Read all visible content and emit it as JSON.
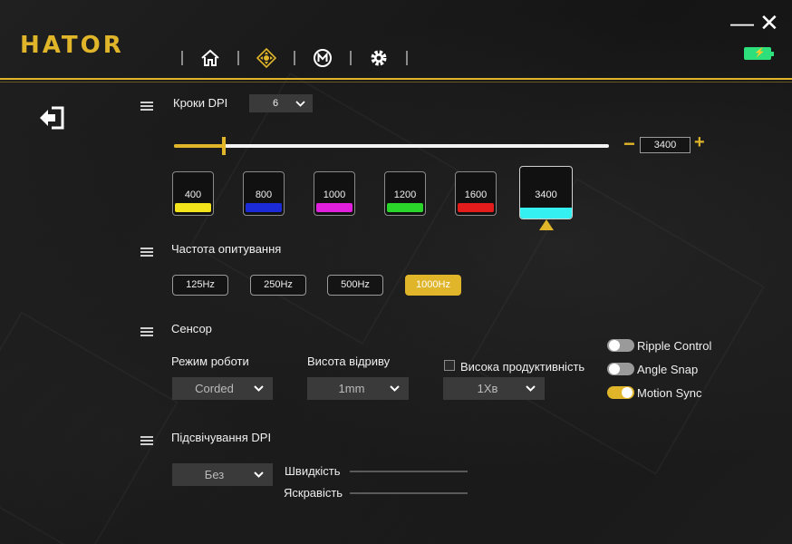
{
  "app": {
    "logo": "HATOR"
  },
  "nav": {
    "items": [
      "home-icon",
      "dpi-icon",
      "macro-icon",
      "settings-icon"
    ]
  },
  "window": {
    "minimize": "—",
    "close": "✕"
  },
  "dpi_steps": {
    "title": "Кроки DPI",
    "steps_value": "6"
  },
  "dpi_slider": {
    "value": "3400",
    "fill_fraction": 0.115,
    "minus": "−",
    "plus": "+"
  },
  "dpi_levels": [
    {
      "label": "400",
      "color": "#f2e31b"
    },
    {
      "label": "800",
      "color": "#1c2bd8"
    },
    {
      "label": "1000",
      "color": "#e01fdc"
    },
    {
      "label": "1200",
      "color": "#2ad62a"
    },
    {
      "label": "1600",
      "color": "#e41c1c"
    },
    {
      "label": "3400",
      "color": "#35f0f0",
      "selected": true
    }
  ],
  "polling": {
    "title": "Частота опитування",
    "options": [
      "125Hz",
      "250Hz",
      "500Hz",
      "1000Hz"
    ],
    "selected": "1000Hz"
  },
  "sensor": {
    "title": "Сенсор",
    "mode_label": "Режим роботи",
    "mode_value": "Corded",
    "lod_label": "Висота відриву",
    "lod_value": "1mm",
    "high_perf_label": "Висока продуктивність",
    "high_perf_value": "1Xв",
    "toggles": [
      {
        "label": "Ripple Control",
        "on": false
      },
      {
        "label": "Angle Snap",
        "on": false
      },
      {
        "label": "Motion Sync",
        "on": true
      }
    ]
  },
  "lighting": {
    "title": "Підсвічування DPI",
    "mode_value": "Без",
    "speed_label": "Швидкість",
    "brightness_label": "Яскравість"
  },
  "colors": {
    "accent": "#e0b52a",
    "battery": "#2de07c"
  }
}
